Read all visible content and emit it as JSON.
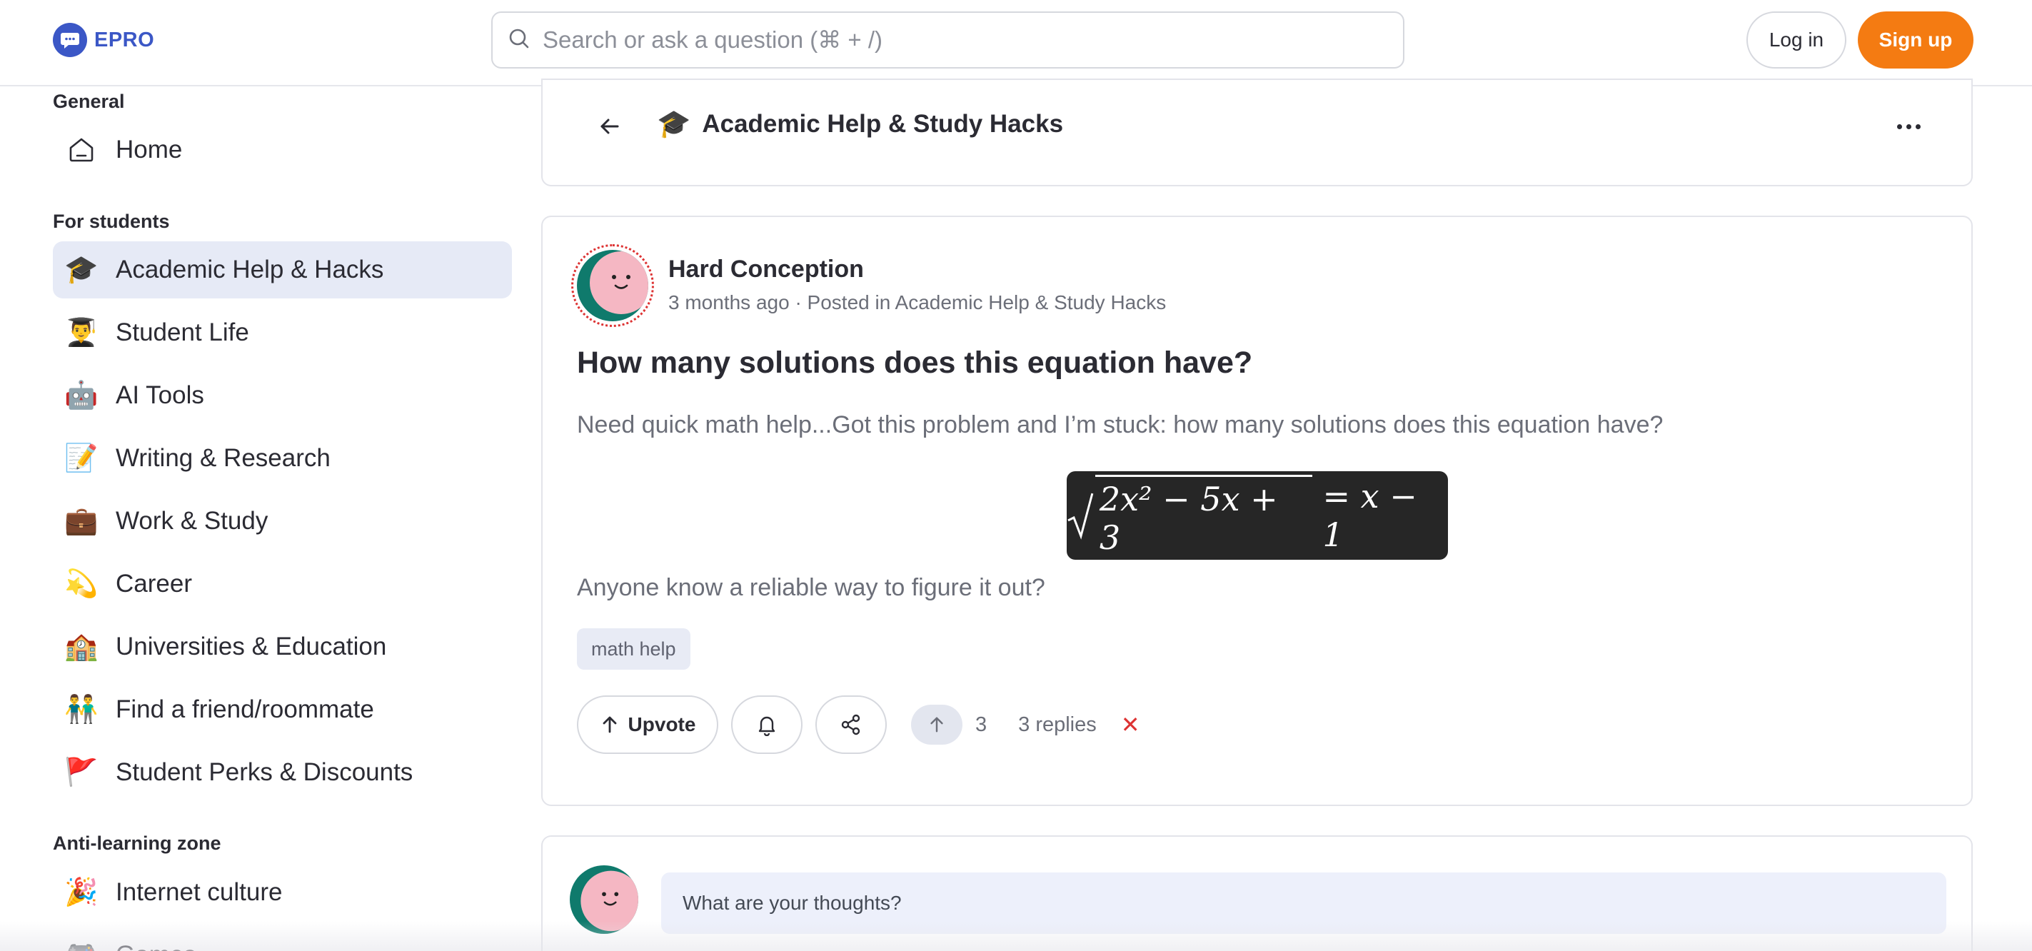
{
  "app": {
    "logo_text": "EPRO",
    "brand_color": "#3b57c6",
    "accent_color": "#f47b12"
  },
  "topbar": {
    "search_placeholder": "Search or ask a question (⌘ + /)",
    "login_label": "Log in",
    "signup_label": "Sign up"
  },
  "sidebar": {
    "general_title": "General",
    "general_items": [
      {
        "label": "Home",
        "icon": "home-icon"
      }
    ],
    "students_title": "For students",
    "students_items": [
      {
        "label": "Academic Help & Hacks",
        "emoji": "🎓",
        "active": true
      },
      {
        "label": "Student Life",
        "emoji": "👨‍🎓"
      },
      {
        "label": "AI Tools",
        "emoji": "🤖"
      },
      {
        "label": "Writing & Research",
        "emoji": "📝"
      },
      {
        "label": "Work & Study",
        "emoji": "💼"
      },
      {
        "label": "Career",
        "emoji": "💫"
      },
      {
        "label": "Universities & Education",
        "emoji": "🏫"
      },
      {
        "label": "Find a friend/roommate",
        "emoji": "👬"
      },
      {
        "label": "Student Perks & Discounts",
        "emoji": "🚩"
      }
    ],
    "anti_title": "Anti-learning zone",
    "anti_items": [
      {
        "label": "Internet culture",
        "emoji": "🎉"
      },
      {
        "label": "Games",
        "emoji": "🎮"
      }
    ]
  },
  "community_header": {
    "emoji": "🎓",
    "title": "Academic Help & Study Hacks"
  },
  "post": {
    "author": "Hard Conception",
    "meta": "3 months ago · Posted in Academic Help & Study Hacks",
    "title": "How many solutions does this equation have?",
    "body": "Need quick math help...Got this problem and I’m stuck: how many solutions does this equation have?",
    "equation": {
      "radicand": "2x² − 5x + 3",
      "rhs": "= x − 1"
    },
    "body2": "Anyone know a reliable way to figure it out?",
    "tag": "math help",
    "upvote_label": "Upvote",
    "vote_count": "3",
    "replies_label": "3 replies",
    "close_symbol": "✕"
  },
  "comment": {
    "placeholder": "What are your thoughts?"
  }
}
